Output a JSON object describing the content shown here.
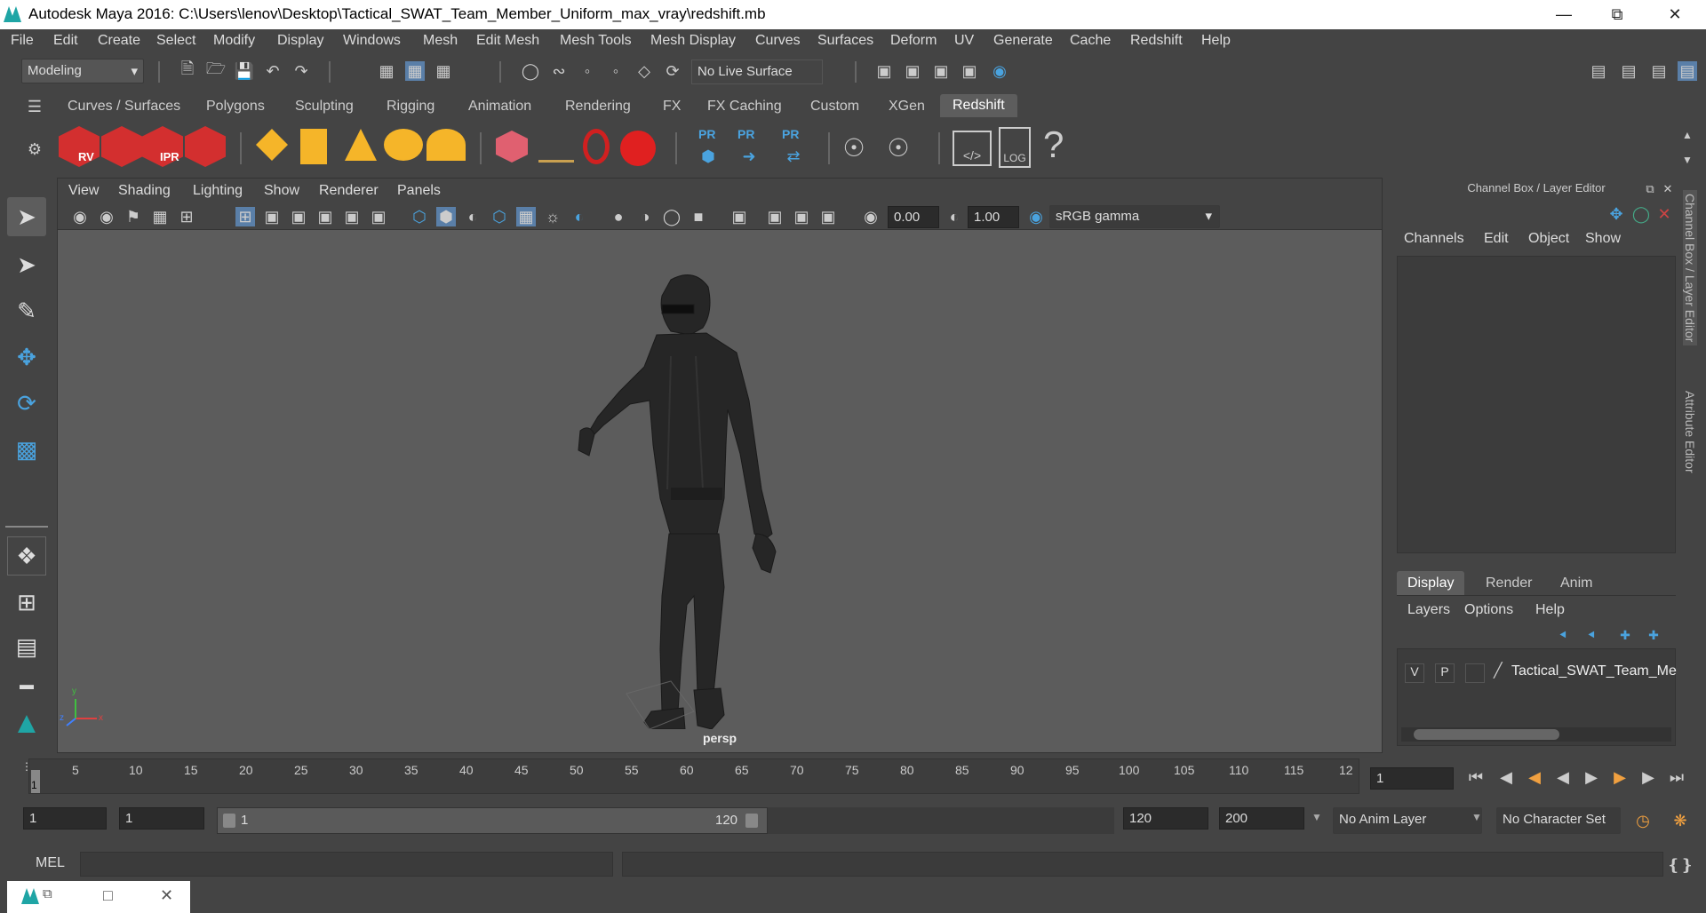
{
  "window": {
    "title": "Autodesk Maya 2016: C:\\Users\\lenov\\Desktop\\Tactical_SWAT_Team_Member_Uniform_max_vray\\redshift.mb",
    "minimize": "—",
    "maximize": "⧉",
    "close": "✕"
  },
  "menubar": [
    "File",
    "Edit",
    "Create",
    "Select",
    "Modify",
    "Display",
    "Windows",
    "Mesh",
    "Edit Mesh",
    "Mesh Tools",
    "Mesh Display",
    "Curves",
    "Surfaces",
    "Deform",
    "UV",
    "Generate",
    "Cache",
    "Redshift",
    "Help"
  ],
  "statusline": {
    "mode": "Modeling",
    "live_surface": "No Live Surface"
  },
  "shelf_tabs": [
    "Curves / Surfaces",
    "Polygons",
    "Sculpting",
    "Rigging",
    "Animation",
    "Rendering",
    "FX",
    "FX Caching",
    "Custom",
    "XGen",
    "Redshift"
  ],
  "shelf_active": "Redshift",
  "shelf": {
    "rv": "RV",
    "ipr": "IPR",
    "pr1": "PR",
    "pr2": "PR",
    "pr3": "PR",
    "log": "LOG",
    "help": "?"
  },
  "viewport": {
    "menu": [
      "View",
      "Shading",
      "Lighting",
      "Show",
      "Renderer",
      "Panels"
    ],
    "exposure": "0.00",
    "gamma": "1.00",
    "color_space": "sRGB gamma",
    "camera": "persp",
    "axis_y": "y",
    "axis_x": "x",
    "axis_z": "z"
  },
  "channel_box": {
    "header": "Channel Box / Layer Editor",
    "menu": [
      "Channels",
      "Edit",
      "Object",
      "Show"
    ],
    "layer_tabs": [
      "Display",
      "Render",
      "Anim"
    ],
    "layer_active": "Display",
    "layer_menu": [
      "Layers",
      "Options",
      "Help"
    ],
    "layer_row": {
      "v": "V",
      "p": "P",
      "name": "Tactical_SWAT_Team_Me"
    }
  },
  "side_tabs": [
    "Channel Box / Layer Editor",
    "Attribute Editor"
  ],
  "timeline": {
    "start_marker": "1",
    "ticks": [
      "5",
      "10",
      "15",
      "20",
      "25",
      "30",
      "35",
      "40",
      "45",
      "50",
      "55",
      "60",
      "65",
      "70",
      "75",
      "80",
      "85",
      "90",
      "95",
      "100",
      "105",
      "110",
      "115",
      "12"
    ],
    "current_frame": "1"
  },
  "range": {
    "start": "1",
    "inner_start": "1",
    "slider_start": "1",
    "slider_end": "120",
    "inner_end": "120",
    "end": "200",
    "anim_layer": "No Anim Layer",
    "char_set": "No Character Set"
  },
  "cmdline": {
    "label": "MEL"
  }
}
